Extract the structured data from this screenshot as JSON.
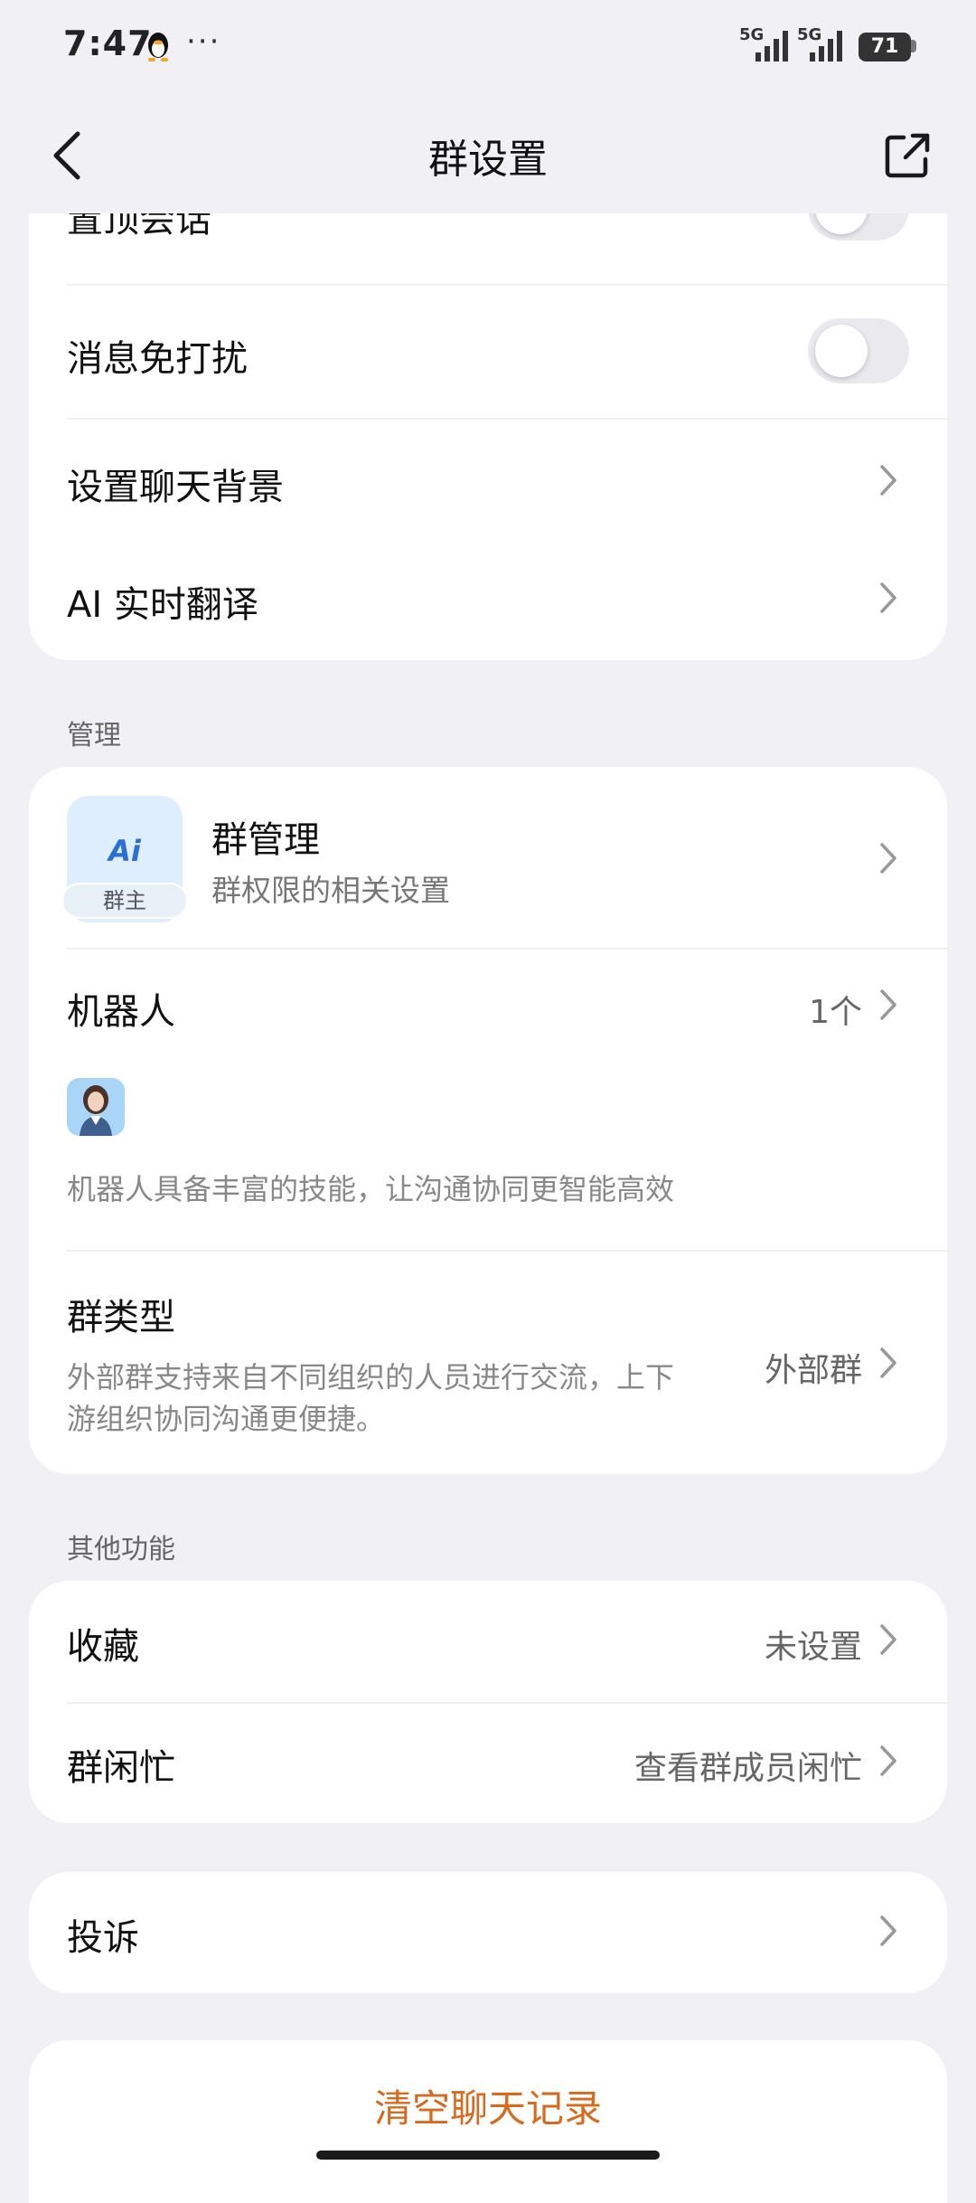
{
  "status_bar": {
    "time": "7:47",
    "more": "···",
    "signal_1": "5G",
    "signal_2": "5G",
    "battery": "71"
  },
  "nav": {
    "title": "群设置"
  },
  "chat_section": {
    "pin_chat_label": "置顶会话",
    "pin_chat_on": false,
    "mute_label": "消息免打扰",
    "mute_on": false,
    "background_label": "设置聊天背景",
    "translate_label": "AI 实时翻译"
  },
  "manage_section": {
    "title": "管理",
    "group_manage": {
      "avatar_text": "Ai",
      "avatar_tag": "群主",
      "label": "群管理",
      "subtitle": "群权限的相关设置"
    },
    "robot": {
      "label": "机器人",
      "count": "1个",
      "desc": "机器人具备丰富的技能，让沟通协同更智能高效"
    },
    "group_type": {
      "label": "群类型",
      "value": "外部群",
      "desc_line1": "外部群支持来自不同组织的人员进行交流，上下",
      "desc_line2": "游组织协同沟通更便捷。"
    }
  },
  "other_section": {
    "title": "其他功能",
    "favorite": {
      "label": "收藏",
      "value": "未设置"
    },
    "busy": {
      "label": "群闲忙",
      "value": "查看群成员闲忙"
    }
  },
  "complaint": {
    "label": "投诉"
  },
  "clear_history": {
    "label": "清空聊天记录"
  },
  "colors": {
    "background": "#f0f0f5",
    "card": "#ffffff",
    "danger": "#d9691c",
    "toggle_off": "#e9e9ee"
  }
}
